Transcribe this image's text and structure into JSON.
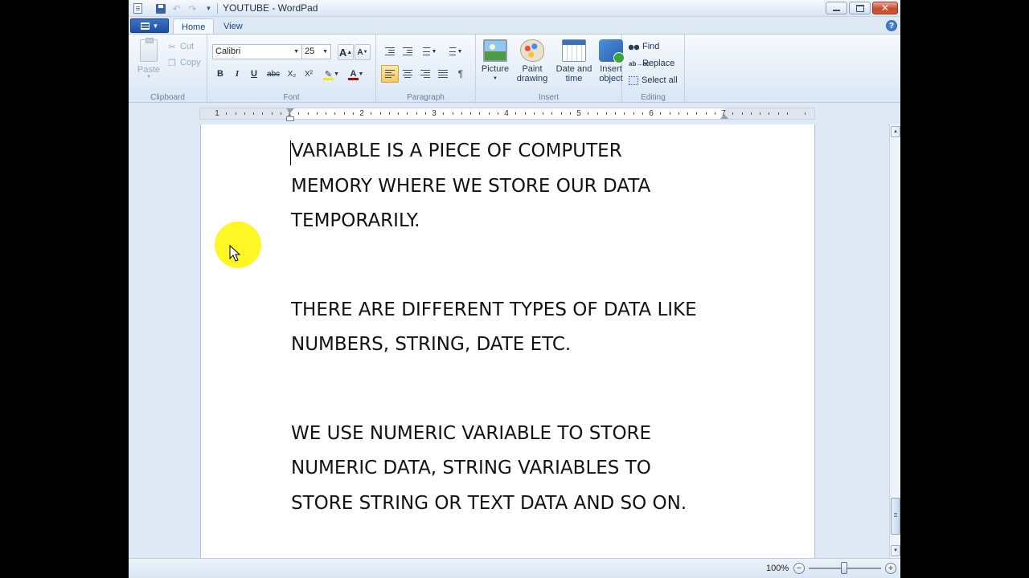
{
  "window": {
    "title": "YOUTUBE - WordPad",
    "close_glyph": "✕"
  },
  "tabs": [
    {
      "label": "Home",
      "active": true
    },
    {
      "label": "View",
      "active": false
    }
  ],
  "help_glyph": "?",
  "ribbon": {
    "clipboard": {
      "label": "Clipboard",
      "paste": "Paste",
      "cut": "Cut",
      "copy": "Copy"
    },
    "font": {
      "label": "Font",
      "family": "Calibri",
      "size": "25",
      "grow_glyph": "A",
      "shrink_glyph": "A",
      "bold_glyph": "B",
      "italic_glyph": "I",
      "underline_glyph": "U",
      "strike_glyph": "abc",
      "subscript_glyph": "X₂",
      "superscript_glyph": "X²",
      "highlight_glyph": "✎",
      "fontcolor_glyph": "A",
      "highlight_color": "#f5e90a",
      "font_color": "#c00000"
    },
    "paragraph": {
      "label": "Paragraph",
      "paragraph_glyph": "¶"
    },
    "insert": {
      "label": "Insert",
      "picture": "Picture",
      "paint_drawing_1": "Paint",
      "paint_drawing_2": "drawing",
      "date_time_1": "Date and",
      "date_time_2": "time",
      "insert_object_1": "Insert",
      "insert_object_2": "object"
    },
    "editing": {
      "label": "Editing",
      "find": "Find",
      "replace": "Replace",
      "replace_glyph": "ab→ac",
      "select_all": "Select all"
    }
  },
  "ruler": {
    "numbers": [
      "1",
      "1",
      "2",
      "3",
      "4",
      "5",
      "6",
      "7"
    ]
  },
  "document": {
    "paragraphs": [
      "VARIABLE IS A PIECE OF COMPUTER\nMEMORY WHERE WE STORE OUR DATA\nTEMPORARILY.",
      "THERE ARE DIFFERENT TYPES OF DATA LIKE\nNUMBERS, STRING, DATE ETC.",
      "WE USE NUMERIC VARIABLE TO STORE\nNUMERIC DATA, STRING VARIABLES TO\nSTORE STRING OR TEXT DATA AND SO ON."
    ]
  },
  "status": {
    "zoom": "100%",
    "zoom_out_glyph": "−",
    "zoom_in_glyph": "+"
  },
  "colors": {
    "accent": "#1c4fa3",
    "cursor_highlight": "#fff500",
    "active_align": "#f6c75d"
  }
}
